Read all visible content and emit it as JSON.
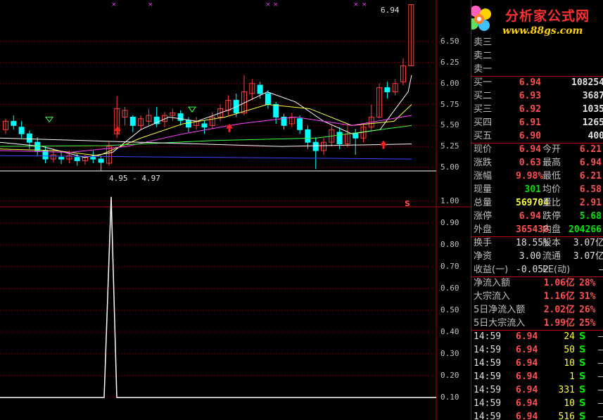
{
  "axis": {
    "price_labels": [
      "6.50",
      "6.25",
      "6.00",
      "5.75",
      "5.50",
      "5.25",
      "5.00"
    ],
    "indicator_labels": [
      "1.00",
      "0.90",
      "0.80",
      "0.70",
      "0.60",
      "0.50",
      "0.40",
      "0.30",
      "0.20",
      "0.10"
    ]
  },
  "annotations": {
    "high_price": "6.94",
    "low_range": "4.95 - 4.97",
    "marker_s": "S"
  },
  "logo": {
    "title": "分析家公式网",
    "url": "www.88gs.com"
  },
  "quote": {
    "asks": [
      {
        "label": "卖三",
        "price": "",
        "vol": ""
      },
      {
        "label": "卖二",
        "price": "",
        "vol": ""
      },
      {
        "label": "卖一",
        "price": "",
        "vol": ""
      }
    ],
    "bids": [
      {
        "label": "买一",
        "price": "6.94",
        "vol": "108254"
      },
      {
        "label": "买二",
        "price": "6.93",
        "vol": "3687"
      },
      {
        "label": "买三",
        "price": "6.92",
        "vol": "1035"
      },
      {
        "label": "买四",
        "price": "6.91",
        "vol": "1265"
      },
      {
        "label": "买五",
        "price": "6.90",
        "vol": "400"
      }
    ],
    "stats": [
      {
        "l1": "现价",
        "v1": "6.94",
        "l2": "今开",
        "v2": "6.21"
      },
      {
        "l1": "涨跌",
        "v1": "0.63",
        "l2": "最高",
        "v2": "6.94"
      },
      {
        "l1": "涨幅",
        "v1": "9.98%",
        "l2": "最低",
        "v2": "6.21"
      },
      {
        "l1": "现量",
        "v1": "301",
        "l2": "均价",
        "v2": "6.58"
      },
      {
        "l1": "总量",
        "v1": "569704",
        "l2": "量比",
        "v2": "2.91"
      },
      {
        "l1": "涨停",
        "v1": "6.94",
        "l2": "跌停",
        "v2": "5.68"
      },
      {
        "l1": "外盘",
        "v1": "365438",
        "l2": "内盘",
        "v2": "204266"
      }
    ],
    "fundamentals": [
      {
        "l1": "换手",
        "v1": "18.55%",
        "l2": "股本",
        "v2": "3.07亿"
      },
      {
        "l1": "净资",
        "v1": "3.00",
        "l2": "流通",
        "v2": "3.07亿"
      },
      {
        "l1": "收益(一)",
        "v1": "-0.052",
        "l2": "PE(动)",
        "v2": "—"
      }
    ],
    "flows": [
      {
        "label": "净流入额",
        "amount": "1.06亿",
        "pct": "28%"
      },
      {
        "label": "大宗流入",
        "amount": "1.16亿",
        "pct": "31%"
      },
      {
        "label": "5日净流入额",
        "amount": "2.02亿",
        "pct": "26%"
      },
      {
        "label": "5日大宗流入",
        "amount": "1.99亿",
        "pct": "25%"
      }
    ],
    "ticks": [
      {
        "time": "14:59",
        "price": "6.94",
        "vol": "24",
        "side": "S",
        "dash": "—"
      },
      {
        "time": "14:59",
        "price": "6.94",
        "vol": "50",
        "side": "S",
        "dash": "—"
      },
      {
        "time": "14:59",
        "price": "6.94",
        "vol": "10",
        "side": "S",
        "dash": "—"
      },
      {
        "time": "14:59",
        "price": "6.94",
        "vol": "1",
        "side": "S",
        "dash": "—"
      },
      {
        "time": "14:59",
        "price": "6.94",
        "vol": "331",
        "side": "S",
        "dash": "—"
      },
      {
        "time": "14:59",
        "price": "6.94",
        "vol": "10",
        "side": "S",
        "dash": "—"
      },
      {
        "time": "14:59",
        "price": "6.94",
        "vol": "516",
        "side": "S",
        "dash": "—"
      }
    ]
  },
  "colors": {
    "up": "#ff4040",
    "down": "#00ffff",
    "panel_border": "#b00000",
    "accent": "#ffff40"
  }
}
